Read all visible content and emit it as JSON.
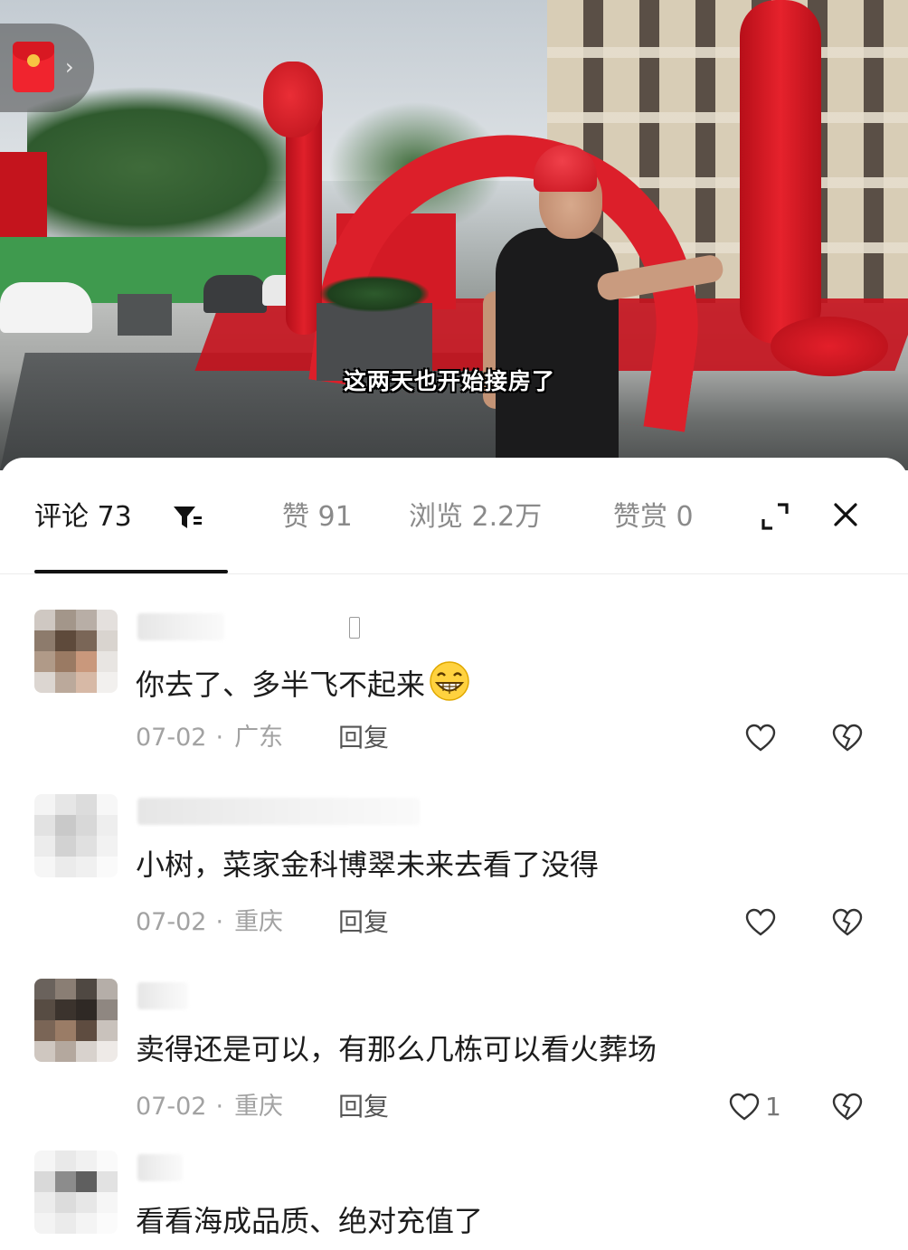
{
  "video": {
    "subtitle": "这两天也开始接房了"
  },
  "header": {
    "tabs": [
      {
        "label": "评论 73",
        "active": true
      },
      {
        "label": "赞 91",
        "active": false
      },
      {
        "label": "浏览 2.2万",
        "active": false
      },
      {
        "label": "赞赏 0",
        "active": false
      }
    ],
    "icons": [
      "filter-icon",
      "expand-icon",
      "close-icon"
    ]
  },
  "comments": [
    {
      "text": "你去了、多半飞不起来",
      "date": "07-02",
      "location": "广东",
      "reply_label": "回复",
      "likes": ""
    },
    {
      "text": "小树，菜家金科博翠未来去看了没得",
      "date": "07-02",
      "location": "重庆",
      "reply_label": "回复",
      "likes": ""
    },
    {
      "text": "卖得还是可以，有那么几栋可以看火葬场",
      "date": "07-02",
      "location": "重庆",
      "reply_label": "回复",
      "likes": "1"
    },
    {
      "text": "看看海成品质、绝对充值了"
    }
  ],
  "colors": {
    "accent_red": "#e3212c",
    "text_primary": "#1c1c1c",
    "text_secondary": "#a2a2a2",
    "tab_inactive": "#8a8a8a"
  }
}
